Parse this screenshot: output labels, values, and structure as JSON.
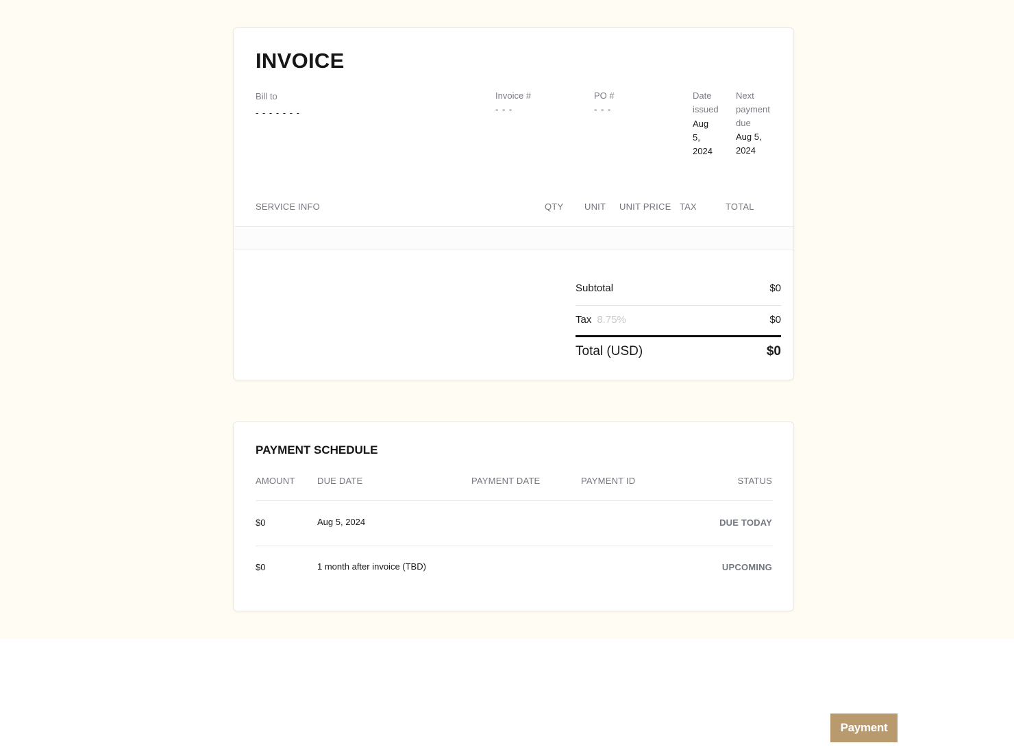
{
  "invoice": {
    "title": "INVOICE",
    "bill_to_label": "Bill to",
    "bill_to_value": "- - - - - - -",
    "invoice_no_label": "Invoice #",
    "invoice_no_value": "- - -",
    "po_label": "PO #",
    "po_value": "- - -",
    "date_issued_label_1": "Date",
    "date_issued_label_2": "issued",
    "date_issued_value_1": "Aug",
    "date_issued_value_2": "5,",
    "date_issued_value_3": "2024",
    "next_due_label_1": "Next",
    "next_due_label_2": "payment",
    "next_due_label_3": "due",
    "next_due_value_1": "Aug 5,",
    "next_due_value_2": "2024",
    "columns": {
      "service_info": "SERVICE INFO",
      "qty": "QTY",
      "unit": "UNIT",
      "unit_price": "UNIT PRICE",
      "tax": "TAX",
      "total": "TOTAL"
    },
    "totals": {
      "subtotal_label": "Subtotal",
      "subtotal_value": "$0",
      "tax_label": "Tax",
      "tax_rate_placeholder": "8.75%",
      "tax_value": "$0",
      "total_label": "Total (USD)",
      "total_value": "$0"
    }
  },
  "schedule": {
    "title": "PAYMENT SCHEDULE",
    "columns": {
      "amount": "AMOUNT",
      "due_date": "DUE DATE",
      "payment_date": "PAYMENT DATE",
      "payment_id": "PAYMENT ID",
      "status": "STATUS"
    },
    "rows": [
      {
        "amount": "$0",
        "due_date": "Aug 5, 2024",
        "payment_date": "",
        "payment_id": "",
        "status": "DUE TODAY"
      },
      {
        "amount": "$0",
        "due_date": "1 month after invoice (TBD)",
        "payment_date": "",
        "payment_id": "",
        "status": "UPCOMING"
      }
    ]
  },
  "payment_button": {
    "label": "Payment",
    "color": "#b89a6e"
  },
  "colors": {
    "page_background": "#fffcf4",
    "muted_text": "#737780"
  }
}
